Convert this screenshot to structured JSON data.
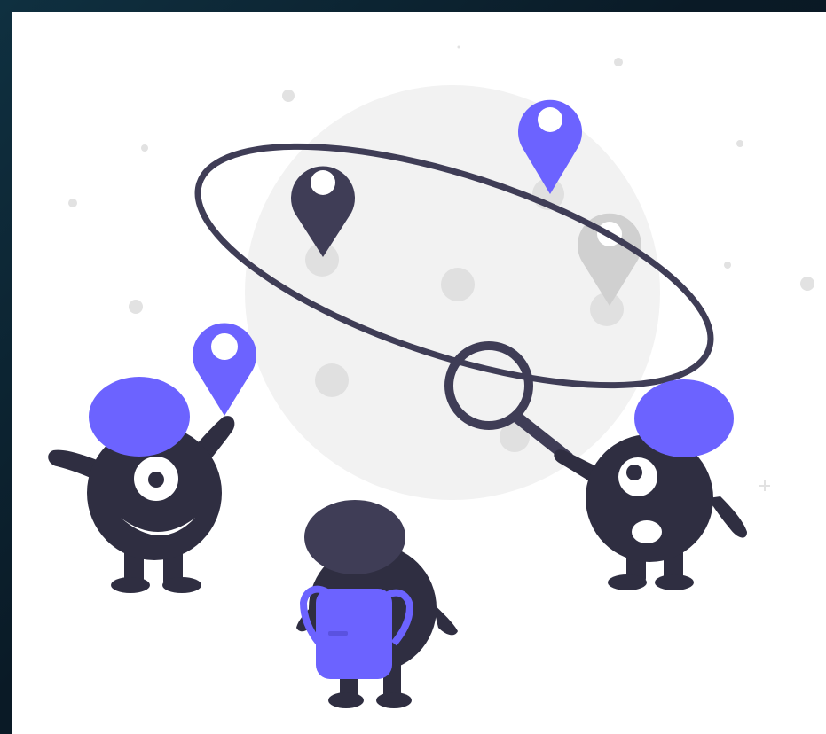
{
  "illustration": {
    "subject": "explorers-around-planet",
    "icons": [
      "map-pin-icon",
      "magnifier-icon"
    ]
  },
  "colors": {
    "background_frame": "#0c1e2a",
    "card": "#ffffff",
    "planet": "#f2f2f2",
    "crater": "#e0e0e0",
    "dark": "#2f2e41",
    "dark_alt": "#3f3d56",
    "accent": "#6c63ff",
    "pin_gray": "#d0d0d0",
    "dot": "#e2e2e2"
  }
}
